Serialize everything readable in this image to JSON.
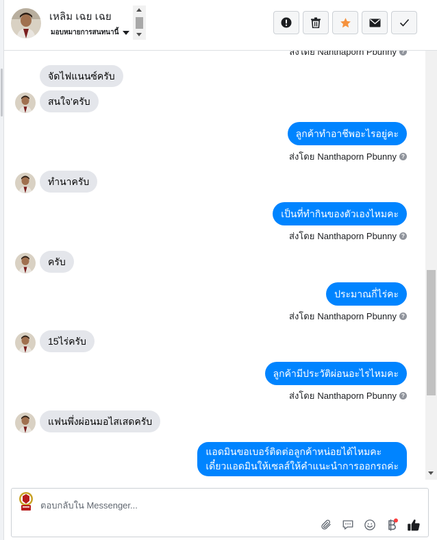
{
  "header": {
    "contact_name": "เหลิม เฉย เฉย",
    "subtitle": "มอบหมายการสนทนานี้",
    "actions": [
      {
        "icon": "alert-icon",
        "name": "spam-button"
      },
      {
        "icon": "trash-icon",
        "name": "delete-button"
      },
      {
        "icon": "star-icon",
        "name": "star-button"
      },
      {
        "icon": "envelope-icon",
        "name": "mark-unread-button"
      },
      {
        "icon": "checkmark-icon",
        "name": "mark-done-button"
      }
    ]
  },
  "messages": {
    "partial_top_sender": "ส่งโดย Nanthaporn Pbunny",
    "sent_by_prefix": "ส่งโดย",
    "agent_name": "Nanthaporn Pbunny",
    "items": [
      {
        "dir": "in",
        "text": "จัดไฟแนนซ์ครับ"
      },
      {
        "dir": "in",
        "text": "สนใจ'ครับ"
      },
      {
        "dir": "out",
        "text": "ลูกค้าทำอาชีพอะไรอยู่คะ"
      },
      {
        "dir": "in",
        "text": "ทำนาครับ"
      },
      {
        "dir": "out",
        "text": "เป็นที่ทำกินของตัวเองไหมคะ"
      },
      {
        "dir": "in",
        "text": "ครับ"
      },
      {
        "dir": "out",
        "text": "ประมาณกี่ไร่คะ"
      },
      {
        "dir": "in",
        "text": "15ไร่ครับ"
      },
      {
        "dir": "out",
        "text": "ลูกค้ามีประวัติผ่อนอะไรไหมคะ"
      },
      {
        "dir": "in",
        "text": "แฟนพึ่งผ่อนมอไสเสดครับ"
      },
      {
        "dir": "out",
        "line1": "แอดมินขอเบอร์ติดต่อลูกค้าหน่อยได้ไหมคะ",
        "line2": "เดี๋ยวแอดมินให้เซลส์ให้คำแนะนำการออกรถค่ะ"
      }
    ]
  },
  "composer": {
    "placeholder": "ตอบกลับใน Messenger...",
    "tools": [
      "paperclip-icon",
      "chat-bubble-icon",
      "smiley-icon",
      "baht-icon",
      "thumbs-up-icon"
    ]
  },
  "colors": {
    "outgoing_bubble": "#0084ff",
    "incoming_bubble": "#e4e6eb",
    "star_accent": "#f5923e",
    "notification_dot": "#fa3e3e",
    "like_icon": "#1c1e21"
  }
}
